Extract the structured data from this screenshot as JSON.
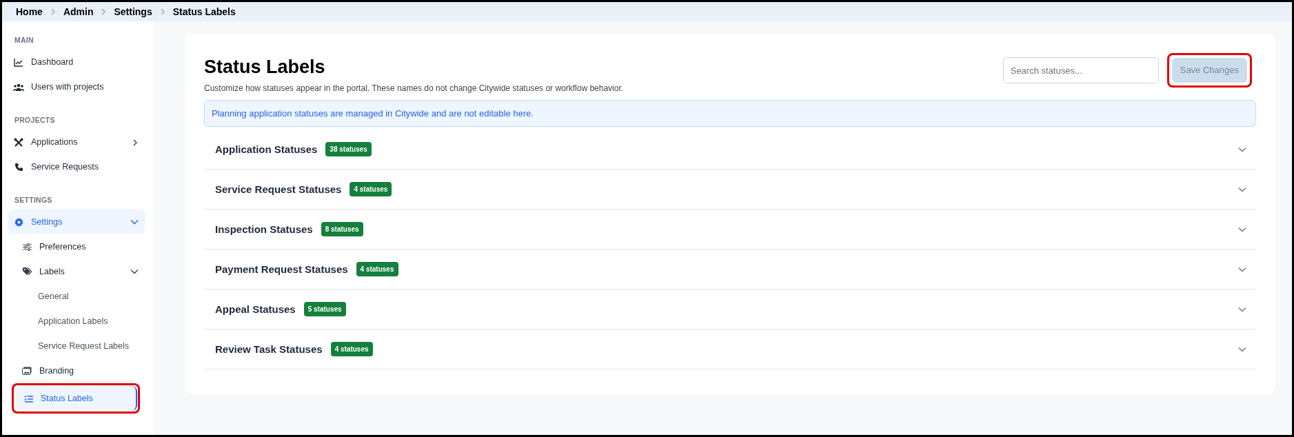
{
  "breadcrumb": [
    "Home",
    "Admin",
    "Settings",
    "Status Labels"
  ],
  "sidebar": {
    "sections": [
      {
        "heading": "MAIN",
        "items": [
          {
            "label": "Dashboard",
            "selected": false
          },
          {
            "label": "Users with projects",
            "selected": false
          }
        ]
      },
      {
        "heading": "PROJECTS",
        "items": [
          {
            "label": "Applications",
            "selected": false,
            "expanded": false
          },
          {
            "label": "Service Requests",
            "selected": false
          }
        ]
      },
      {
        "heading": "SETTINGS",
        "items": [
          {
            "label": "Settings",
            "selected": false,
            "expanded": true,
            "children": [
              {
                "label": "Preferences",
                "selected": false
              },
              {
                "label": "Labels",
                "selected": false,
                "expanded": true,
                "children": [
                  {
                    "label": "General",
                    "selected": false
                  },
                  {
                    "label": "Application Labels",
                    "selected": false
                  },
                  {
                    "label": "Service Request Labels",
                    "selected": false
                  }
                ]
              },
              {
                "label": "Branding",
                "selected": false
              },
              {
                "label": "Status Labels",
                "selected": true,
                "highlighted": true
              }
            ]
          }
        ]
      }
    ]
  },
  "page": {
    "title": "Status Labels",
    "subtitle": "Customize how statuses appear in the portal. These names do not change Citywide statuses or workflow behavior.",
    "search": {
      "placeholder": "Search statuses..."
    },
    "save_button": {
      "label": "Save Changes",
      "disabled": true,
      "highlighted": true
    },
    "notice": "Planning application statuses are managed in Citywide and are not editable here.",
    "groups": [
      {
        "title": "Application Statuses",
        "count": "38 statuses",
        "expanded": false
      },
      {
        "title": "Service Request Statuses",
        "count": "4 statuses",
        "expanded": false
      },
      {
        "title": "Inspection Statuses",
        "count": "8 statuses",
        "expanded": false
      },
      {
        "title": "Payment Request Statuses",
        "count": "4 statuses",
        "expanded": false
      },
      {
        "title": "Appeal Statuses",
        "count": "5 statuses",
        "expanded": false
      },
      {
        "title": "Review Task Statuses",
        "count": "4 statuses",
        "expanded": false
      }
    ]
  }
}
